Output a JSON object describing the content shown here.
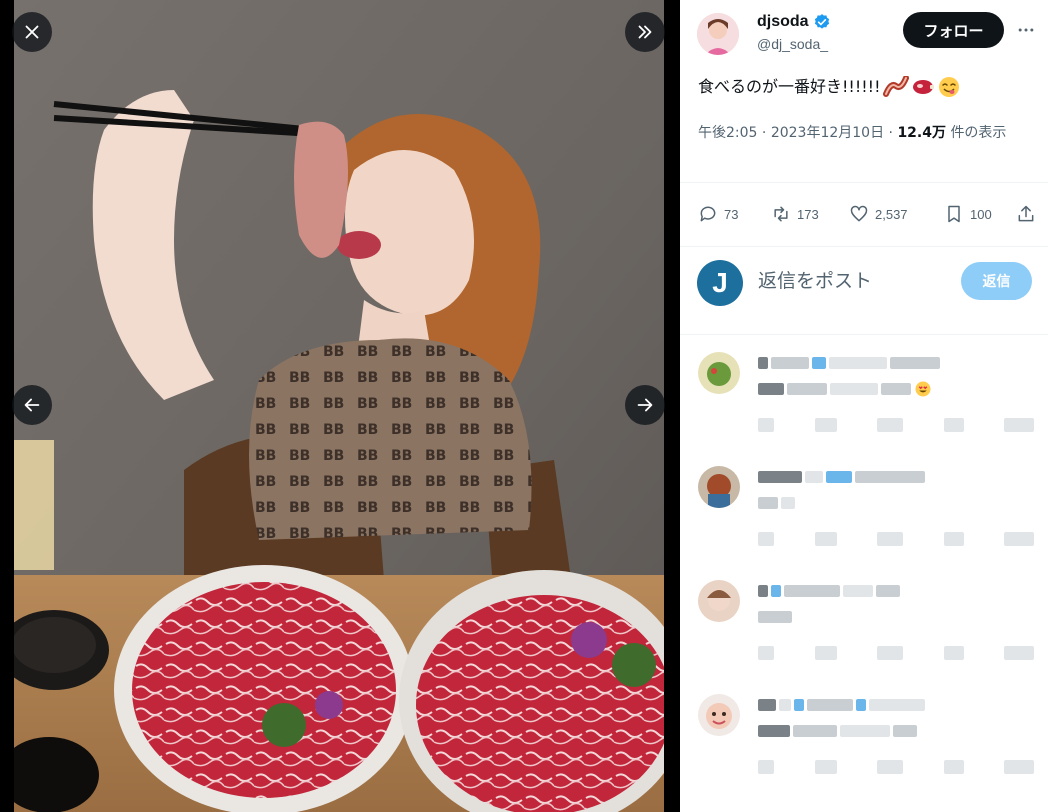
{
  "viewer": {
    "close_icon": "close-icon",
    "expand_icon": "double-chevron-right-icon",
    "prev_icon": "arrow-left-icon",
    "next_icon": "arrow-right-icon"
  },
  "author": {
    "display_name": "djsoda",
    "handle": "@dj_soda_",
    "verified": true,
    "follow_label": "フォロー"
  },
  "tweet": {
    "text": "食べるのが一番好き!!!!!!",
    "emojis": [
      "bacon-emoji",
      "meat-emoji",
      "yum-emoji"
    ],
    "time": "午後2:05",
    "separator": "·",
    "date": "2023年12月10日",
    "views_count": "12.4万",
    "views_suffix": "件の表示"
  },
  "stats": {
    "replies": "73",
    "retweets": "173",
    "likes": "2,537",
    "bookmarks": "100"
  },
  "composer": {
    "avatar_letter": "J",
    "placeholder": "返信をポスト",
    "reply_label": "返信"
  },
  "colors": {
    "follow_bg": "#0f1419",
    "reply_btn_bg": "#8ecdf7",
    "verified_blue": "#1d9bf0",
    "secondary_text": "#536471"
  }
}
